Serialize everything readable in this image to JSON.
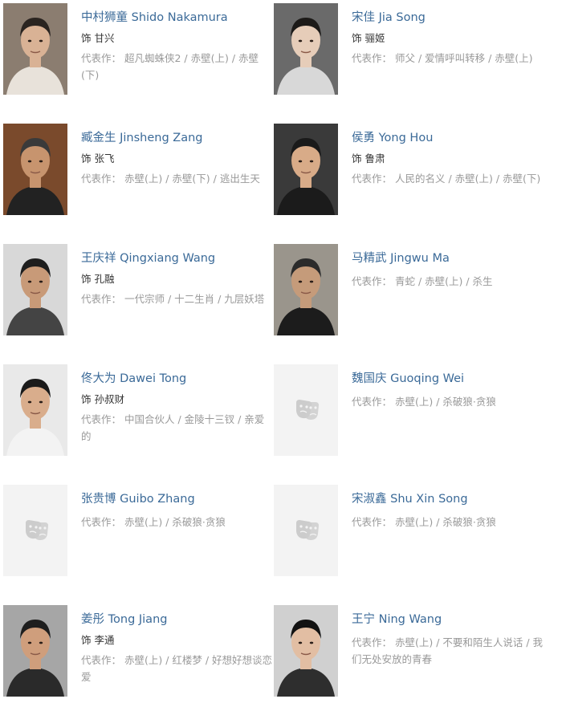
{
  "works_label": "代表作：",
  "cast": [
    {
      "name": "中村狮童 Shido Nakamura",
      "role": "饰 甘兴",
      "works": "超凡蜘蛛侠2 / 赤壁(上) / 赤壁(下)",
      "photo": "portrait",
      "avatar_icon": "person-photo"
    },
    {
      "name": "宋佳 Jia Song",
      "role": "饰 骊姬",
      "works": "师父 / 爱情呼叫转移 / 赤壁(上)",
      "photo": "portrait",
      "avatar_icon": "person-photo"
    },
    {
      "name": "臧金生 Jinsheng Zang",
      "role": "饰 张飞",
      "works": "赤壁(上) / 赤壁(下) / 逃出生天",
      "photo": "portrait",
      "avatar_icon": "person-photo"
    },
    {
      "name": "侯勇 Yong Hou",
      "role": "饰 鲁肃",
      "works": "人民的名义 / 赤壁(上) / 赤壁(下)",
      "photo": "portrait",
      "avatar_icon": "person-photo"
    },
    {
      "name": "王庆祥 Qingxiang Wang",
      "role": "饰 孔融",
      "works": "一代宗师 / 十二生肖 / 九层妖塔",
      "photo": "portrait",
      "avatar_icon": "person-photo"
    },
    {
      "name": "马精武 Jingwu Ma",
      "role": "",
      "works": "青蛇 / 赤壁(上) / 杀生",
      "photo": "portrait",
      "avatar_icon": "person-photo"
    },
    {
      "name": "佟大为 Dawei Tong",
      "role": "饰 孙叔财",
      "works": "中国合伙人 / 金陵十三钗 / 亲爱的",
      "photo": "portrait",
      "avatar_icon": "person-photo"
    },
    {
      "name": "魏国庆 Guoqing Wei",
      "role": "",
      "works": "赤壁(上) / 杀破狼·贪狼",
      "photo": "placeholder",
      "avatar_icon": "theater-mask-icon"
    },
    {
      "name": "张贵博 Guibo Zhang",
      "role": "",
      "works": "赤壁(上) / 杀破狼·贪狼",
      "photo": "placeholder",
      "avatar_icon": "theater-mask-icon"
    },
    {
      "name": "宋淑鑫 Shu Xin Song",
      "role": "",
      "works": "赤壁(上) / 杀破狼·贪狼",
      "photo": "placeholder",
      "avatar_icon": "theater-mask-icon"
    },
    {
      "name": "姜彤 Tong Jiang",
      "role": "饰 李通",
      "works": "赤壁(上) / 红楼梦 / 好想好想谈恋爱",
      "photo": "portrait",
      "avatar_icon": "person-photo"
    },
    {
      "name": "王宁 Ning Wang",
      "role": "",
      "works": "赤壁(上) / 不要和陌生人说话 / 我们无处安放的青春",
      "photo": "portrait",
      "avatar_icon": "person-photo"
    }
  ],
  "colors": {
    "link": "#3b6a98",
    "role_text": "#333333",
    "works_text": "#999999",
    "placeholder_bg": "#f3f3f3",
    "mask_icon": "#cccccc"
  }
}
